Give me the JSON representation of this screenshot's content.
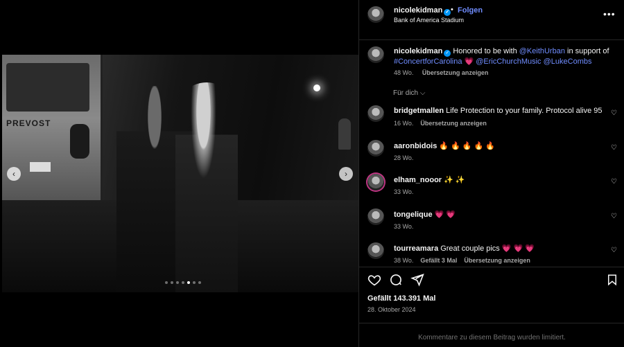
{
  "media": {
    "photo_bus_text": "PREVOST",
    "carousel": {
      "dots_total": 7,
      "active_index": 4
    }
  },
  "post": {
    "username": "nicolekidman",
    "follow_label": "Folgen",
    "separator": "•",
    "location": "Bank of America Stadium",
    "more_icon": "more-horizontal-icon"
  },
  "caption": {
    "username": "nicolekidman",
    "text_1": "Honored to be with ",
    "mention_1": "@KeithUrban",
    "text_2": " in support of ",
    "mention_2": "#ConcertforCarolina",
    "emoji": " 💗 ",
    "mention_3": "@EricChurchMusic",
    "mention_4": "@LukeCombs",
    "age": "48 Wo.",
    "translate": "Übersetzung anzeigen"
  },
  "filter_label": "Für dich",
  "comments": [
    {
      "user": "bridgetmallen",
      "text": "Life Protection to your family. Protocol alive 95",
      "age": "16 Wo.",
      "extra": "",
      "translate": "Übersetzung anzeigen"
    },
    {
      "user": "aaronbidois",
      "text": "🔥 🔥 🔥 🔥 🔥",
      "age": "28 Wo.",
      "extra": "",
      "translate": ""
    },
    {
      "user": "elham_nooor",
      "text": "✨ ✨",
      "age": "33 Wo.",
      "extra": "",
      "translate": ""
    },
    {
      "user": "tongelique",
      "text": "💗 💗",
      "age": "33 Wo.",
      "extra": "",
      "translate": ""
    },
    {
      "user": "tourreamara",
      "text": "Great couple pics 💗 💗 💗",
      "age": "38 Wo.",
      "extra": "Gefällt 3 Mal",
      "translate": "Übersetzung anzeigen"
    }
  ],
  "likes": "Gefällt 143.391 Mal",
  "date": "28. Oktober 2024",
  "comments_limited": "Kommentare zu diesem Beitrag wurden limitiert.",
  "colors": {
    "accent": "#708dff",
    "verified": "#0095f6",
    "secondary_text": "#a8a8a8"
  }
}
